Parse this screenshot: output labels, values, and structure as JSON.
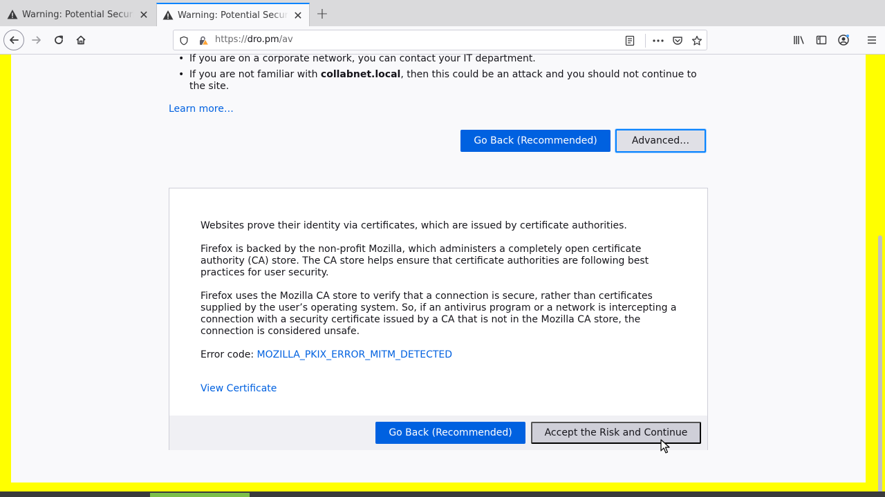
{
  "tabs": [
    {
      "title": "Warning: Potential Security Risk Ahead",
      "active": false
    },
    {
      "title": "Warning: Potential Security Risk Ahead",
      "active": true
    }
  ],
  "url": {
    "scheme": "https://",
    "host": "dro.pm",
    "path": "/av"
  },
  "bullets": {
    "item1": "If you are on a corporate network, you can contact your IT department.",
    "item2_pre": "If you are not familiar with ",
    "item2_bold": "collabnet.local",
    "item2_post": ", then this could be an attack and you should not continue to the site."
  },
  "learn_more": "Learn more…",
  "buttons": {
    "go_back": "Go Back (Recommended)",
    "advanced": "Advanced…",
    "accept": "Accept the Risk and Continue"
  },
  "advanced": {
    "p1": "Websites prove their identity via certificates, which are issued by certificate authorities.",
    "p2": "Firefox is backed by the non-profit Mozilla, which administers a completely open certificate authority (CA) store. The CA store helps ensure that certificate authorities are following best practices for user security.",
    "p3": "Firefox uses the Mozilla CA store to verify that a connection is secure, rather than certificates supplied by the user’s operating system. So, if an antivirus program or a network is intercepting a connection with a security certificate issued by a CA that is not in the Mozilla CA store, the connection is considered unsafe.",
    "error_label": "Error code: ",
    "error_code": "MOZILLA_PKIX_ERROR_MITM_DETECTED",
    "view_certificate": "View Certificate"
  },
  "colors": {
    "accent": "#0061e0",
    "page_highlight": "#ffff00",
    "focus_ring": "#0a84ff"
  },
  "icons": [
    "warning-icon",
    "close-icon",
    "plus-icon",
    "back-arrow-icon",
    "forward-arrow-icon",
    "reload-icon",
    "home-icon",
    "shield-icon",
    "lock-warning-icon",
    "reader-view-icon",
    "more-icon",
    "pocket-icon",
    "star-icon",
    "library-icon",
    "sidebar-icon",
    "account-icon",
    "hamburger-menu-icon"
  ]
}
